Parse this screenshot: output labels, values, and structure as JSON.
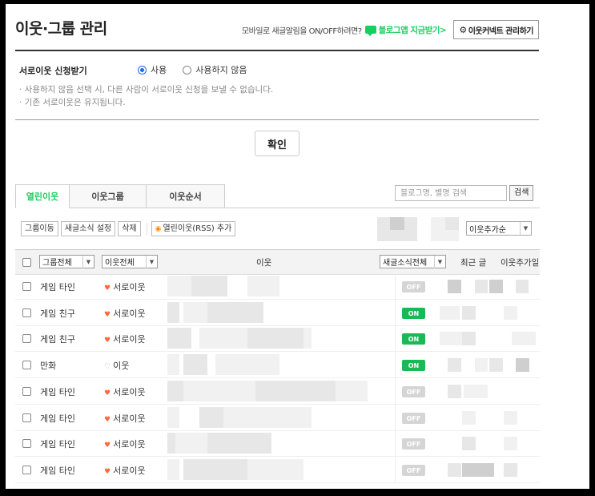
{
  "header": {
    "title": "이웃·그룹 관리",
    "mobile_text": "모바일로 새글알림을 ON/OFF하려면?",
    "app_link": "블로그앱 지금받기>",
    "manage_button": "이웃커넥트 관리하기"
  },
  "option": {
    "label": "서로이웃 신청받기",
    "radio_use": "사용",
    "radio_not_use": "사용하지 않음",
    "selected": "사용",
    "note1": "· 사용하지 않음 선택 시, 다른 사람이 서로이웃 신청을 보낼 수 없습니다.",
    "note2": "· 기존 서로이웃은 유지됩니다."
  },
  "confirm_label": "확인",
  "tabs": [
    {
      "label": "열린이웃",
      "active": true
    },
    {
      "label": "이웃그룹",
      "active": false
    },
    {
      "label": "이웃순서",
      "active": false
    }
  ],
  "search": {
    "placeholder": "블로그명, 별명 검색",
    "button": "검색"
  },
  "toolbar": {
    "move_group": "그룹이동",
    "new_post_setting": "새글소식 설정",
    "delete": "삭제",
    "rss_add": "열린이웃(RSS) 추가",
    "sort_value": "이웃추가순"
  },
  "table": {
    "group_filter": "그룹전체",
    "neighbor_filter": "이웃전체",
    "col_neighbor": "이웃",
    "col_news": "새글소식전체",
    "col_recent": "최근 글",
    "col_added": "이웃추가일",
    "rows": [
      {
        "group": "게임 타인",
        "relation": "서로이웃",
        "mutual": true,
        "news": "OFF"
      },
      {
        "group": "게임 친구",
        "relation": "서로이웃",
        "mutual": true,
        "news": "ON"
      },
      {
        "group": "게임 친구",
        "relation": "서로이웃",
        "mutual": true,
        "news": "ON"
      },
      {
        "group": "만화",
        "relation": "이웃",
        "mutual": false,
        "news": "ON"
      },
      {
        "group": "게임 타인",
        "relation": "서로이웃",
        "mutual": true,
        "news": "OFF"
      },
      {
        "group": "게임 타인",
        "relation": "서로이웃",
        "mutual": true,
        "news": "OFF"
      },
      {
        "group": "게임 타인",
        "relation": "서로이웃",
        "mutual": true,
        "news": "OFF"
      },
      {
        "group": "게임 타인",
        "relation": "서로이웃",
        "mutual": true,
        "news": "OFF"
      }
    ]
  },
  "colors": {
    "accent_green": "#19ce60",
    "on_green": "#19b955",
    "off_gray": "#d5d5d5",
    "mutual_heart": "#ff6a3d"
  }
}
